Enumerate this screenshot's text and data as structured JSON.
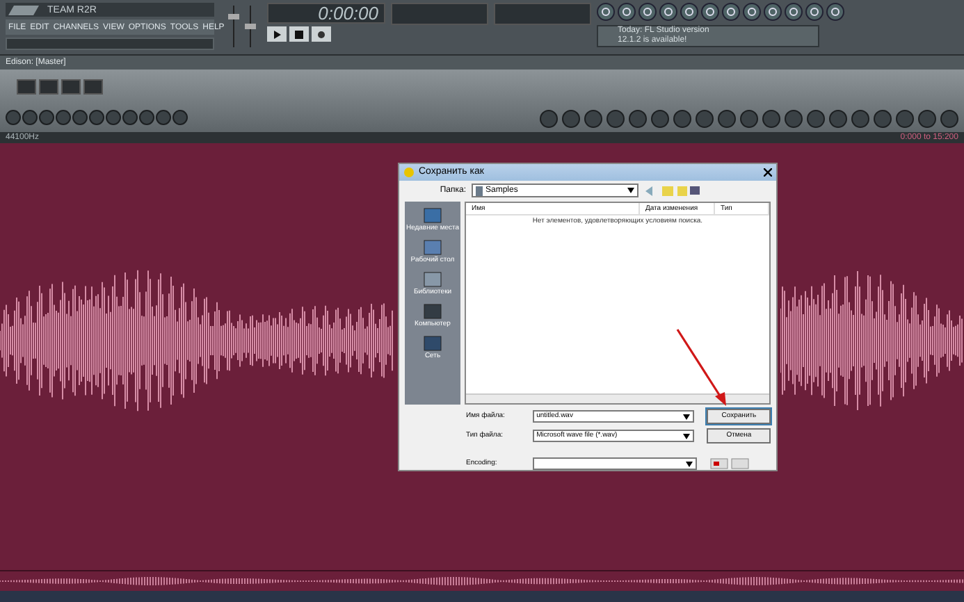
{
  "main_window": {
    "title": "TEAM R2R",
    "menu": [
      "FILE",
      "EDIT",
      "CHANNELS",
      "VIEW",
      "OPTIONS",
      "TOOLS",
      "HELP"
    ],
    "time": "0:00:00",
    "hint": [
      "Today: FL Studio version",
      "12.1.2 is available!"
    ]
  },
  "edison": {
    "title": "Edison: [Master]",
    "sample_rate": "44100Hz",
    "range": "0:000 to 15:200"
  },
  "dialog": {
    "title": "Сохранить как",
    "folder_label": "Папка:",
    "folder": "Samples",
    "places": [
      {
        "label": "Недавние места",
        "kind": "recent"
      },
      {
        "label": "Рабочий стол",
        "kind": "desktop"
      },
      {
        "label": "Библиотеки",
        "kind": "libraries"
      },
      {
        "label": "Компьютер",
        "kind": "computer"
      },
      {
        "label": "Сеть",
        "kind": "network"
      }
    ],
    "columns": [
      "Имя",
      "Дата изменения",
      "Тип"
    ],
    "empty_message": "Нет элементов, удовлетворяющих условиям поиска.",
    "fields": [
      {
        "label": "Имя файла:",
        "value": "untitled.wav"
      },
      {
        "label": "Тип файла:",
        "value": "Microsoft wave file (*.wav)"
      },
      {
        "label": "Encoding:"
      }
    ],
    "buttons": [
      "Сохранить",
      "Отмена"
    ]
  }
}
